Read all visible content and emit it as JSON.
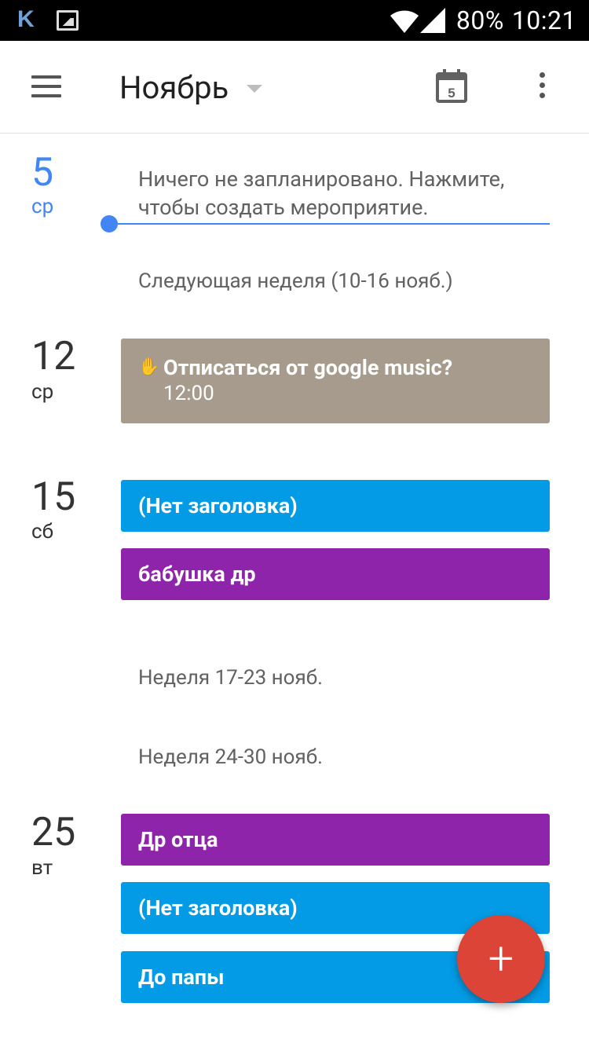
{
  "status_bar": {
    "battery": "80%",
    "time": "10:21",
    "icons": [
      "vk-icon",
      "image-icon",
      "wifi-icon",
      "signal-icon"
    ]
  },
  "app_bar": {
    "title": "Ноябрь",
    "today_icon_label": "5",
    "icons": [
      "menu-icon",
      "dropdown-caret-icon",
      "today-calendar-icon",
      "more-vert-icon"
    ]
  },
  "schedule": {
    "today": {
      "day": "5",
      "weekday": "ср",
      "empty_message": "Ничего не запланировано. Нажмите, чтобы создать мероприятие."
    },
    "week_labels": [
      "Следующая неделя (10-16 нояб.)",
      "Неделя 17-23 нояб.",
      "Неделя 24-30 нояб."
    ],
    "days": [
      {
        "day": "12",
        "weekday": "ср",
        "events": [
          {
            "title": "Отписаться от google music?",
            "time": "12:00",
            "color": "#a69b8d",
            "icon": "reminder-icon"
          }
        ]
      },
      {
        "day": "15",
        "weekday": "сб",
        "events": [
          {
            "title": "(Нет заголовка)",
            "color": "#039be5"
          },
          {
            "title": "бабушка др",
            "color": "#8e24aa"
          }
        ]
      },
      {
        "day": "25",
        "weekday": "вт",
        "events": [
          {
            "title": "Др отца",
            "color": "#8e24aa"
          },
          {
            "title": "(Нет заголовка)",
            "color": "#039be5"
          },
          {
            "title": "До папы",
            "color": "#039be5"
          }
        ]
      }
    ]
  },
  "fab": {
    "label": "+",
    "color": "#db4437"
  },
  "colors": {
    "accent": "#4285f4",
    "header_bg": "#ffffff",
    "status_bar_bg": "#000000"
  }
}
